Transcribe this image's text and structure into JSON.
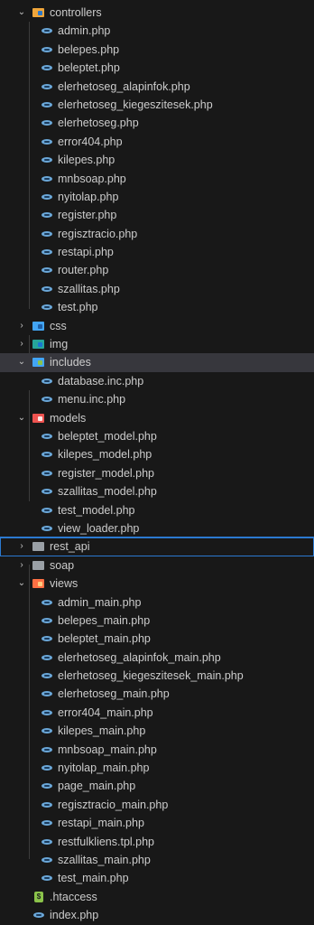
{
  "explorer": {
    "controllers": {
      "label": "controllers",
      "files": [
        "admin.php",
        "belepes.php",
        "beleptet.php",
        "elerhetoseg_alapinfok.php",
        "elerhetoseg_kiegeszitesek.php",
        "elerhetoseg.php",
        "error404.php",
        "kilepes.php",
        "mnbsoap.php",
        "nyitolap.php",
        "register.php",
        "regisztracio.php",
        "restapi.php",
        "router.php",
        "szallitas.php",
        "test.php"
      ]
    },
    "css": {
      "label": "css"
    },
    "img": {
      "label": "img"
    },
    "includes": {
      "label": "includes",
      "files": [
        "database.inc.php",
        "menu.inc.php"
      ]
    },
    "models": {
      "label": "models",
      "files": [
        "beleptet_model.php",
        "kilepes_model.php",
        "register_model.php",
        "szallitas_model.php",
        "test_model.php",
        "view_loader.php"
      ]
    },
    "rest_api": {
      "label": "rest_api"
    },
    "soap": {
      "label": "soap"
    },
    "views": {
      "label": "views",
      "files": [
        "admin_main.php",
        "belepes_main.php",
        "beleptet_main.php",
        "elerhetoseg_alapinfok_main.php",
        "elerhetoseg_kiegeszitesek_main.php",
        "elerhetoseg_main.php",
        "error404_main.php",
        "kilepes_main.php",
        "mnbsoap_main.php",
        "nyitolap_main.php",
        "page_main.php",
        "regisztracio_main.php",
        "restapi_main.php",
        "restfulkliens.tpl.php",
        "szallitas_main.php",
        "test_main.php"
      ]
    },
    "root_files": [
      ".htaccess",
      "index.php"
    ],
    "icons": {
      "chevron_collapsed": "›",
      "chevron_expanded": "⌄",
      "htaccess_glyph": "$"
    }
  }
}
